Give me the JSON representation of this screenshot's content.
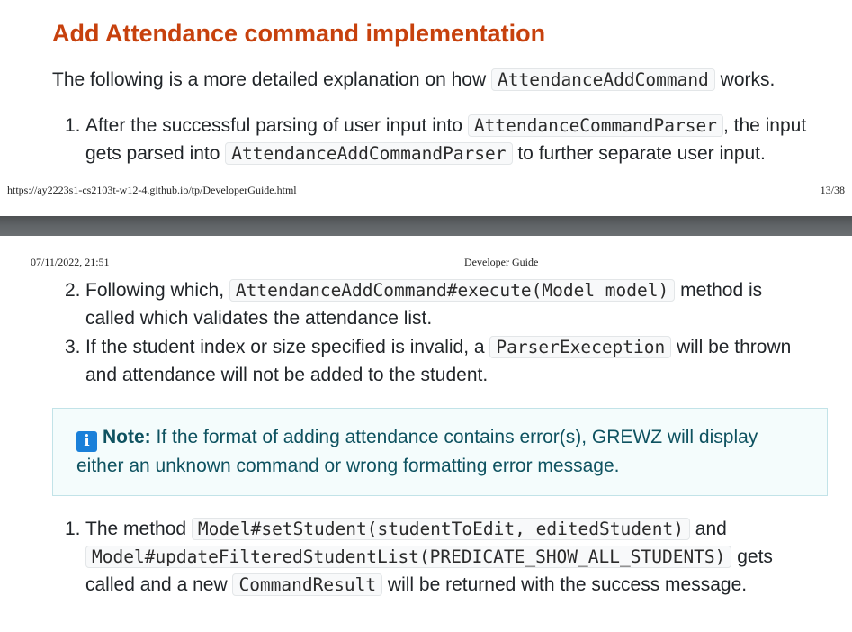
{
  "page1": {
    "heading": "Add Attendance command implementation",
    "intro": {
      "before": "The following is a ",
      "bold": "more",
      "middle": " detailed explanation on how ",
      "code": "AttendanceAddCommand",
      "after": " works."
    },
    "step1": {
      "number": "1.",
      "line1_text": "After the successful parsing of user input into ",
      "line1_code": "AttendanceCommandParser",
      "line1_after": ", the input",
      "line2_text": "gets parsed into ",
      "line2_code": "AttendanceAddCommandParser",
      "line2_after": " to further separate user input."
    },
    "footer_url": "https://ay2223s1-cs2103t-w12-4.github.io/tp/DeveloperGuide.html",
    "footer_page": "13/38"
  },
  "page2": {
    "header_date": "07/11/2022, 21:51",
    "header_title": "Developer Guide",
    "step2": {
      "number": "2.",
      "line1_text": "Following which, ",
      "line1_code": "AttendanceAddCommand#execute(Model model)",
      "line1_after": " method is",
      "line2_text": "called which validates the attendance list."
    },
    "step3": {
      "number": "3.",
      "line1_text": "If the student index or size specified is invalid, a ",
      "line1_code": "ParserExeception",
      "line1_after": " will be thrown",
      "line2_text": "and attendance will not be added to the student."
    },
    "note": {
      "icon": "info-icon",
      "label": "Note:",
      "line1": " If the format of adding attendance contains error(s), GREWZ will display",
      "line2": "either an unknown command or wrong formatting error message."
    },
    "step4": {
      "number": "1.",
      "line1_text": "The method ",
      "line1_code": "Model#setStudent(studentToEdit, editedStudent)",
      "line1_after": " and",
      "line2_code": "Model#updateFilteredStudentList(PREDICATE_SHOW_ALL_STUDENTS)",
      "line2_after": " gets",
      "line3_text": "called and a new ",
      "line3_code": "CommandResult",
      "line3_after": " will be returned with the success message."
    }
  },
  "colors": {
    "heading": "#c7410d",
    "note_text": "#0e5260",
    "note_bg": "#f4fcfc",
    "info_icon": "#1a80d9"
  }
}
